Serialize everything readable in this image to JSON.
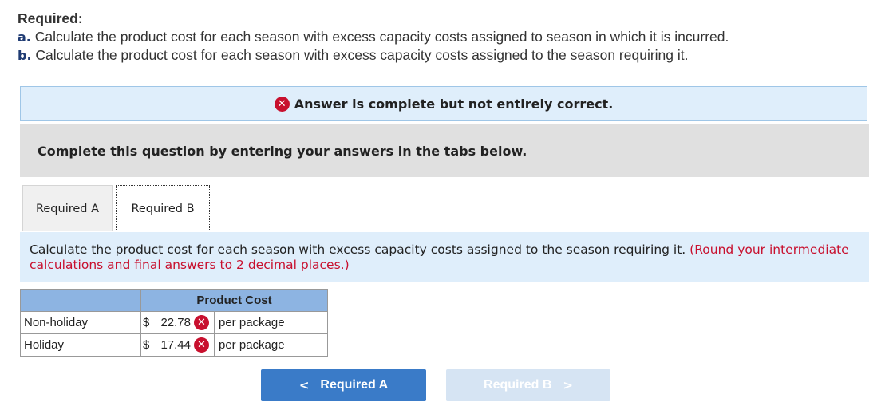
{
  "required": {
    "title": "Required:",
    "items": [
      {
        "letter": "a.",
        "text": "Calculate the product cost for each season with excess capacity costs assigned to season in which it is incurred."
      },
      {
        "letter": "b.",
        "text": "Calculate the product cost for each season with excess capacity costs assigned to the season requiring it."
      }
    ]
  },
  "banner": {
    "icon": "x-circle-icon",
    "text": "Answer is complete but not entirely correct."
  },
  "instructions": "Complete this question by entering your answers in the tabs below.",
  "tabs": [
    {
      "label": "Required A",
      "active": false
    },
    {
      "label": "Required B",
      "active": true
    }
  ],
  "panel": {
    "text": "Calculate the product cost for each season with excess capacity costs assigned to the season requiring it.",
    "note": "(Round your intermediate calculations and final answers to 2 decimal places.)"
  },
  "table": {
    "header": "Product Cost",
    "rows": [
      {
        "label": "Non-holiday",
        "currency": "$",
        "value": "22.78",
        "unit": "per package",
        "status": "incorrect"
      },
      {
        "label": "Holiday",
        "currency": "$",
        "value": "17.44",
        "unit": "per package",
        "status": "incorrect"
      }
    ]
  },
  "nav": {
    "prev_label": "Required A",
    "next_label": "Required B",
    "prev_chevron": "<",
    "next_chevron": ">"
  },
  "colors": {
    "error_red": "#c8102e",
    "banner_bg": "#dfeefb",
    "header_blue": "#8db4e2",
    "button_blue": "#3a7bc8"
  }
}
